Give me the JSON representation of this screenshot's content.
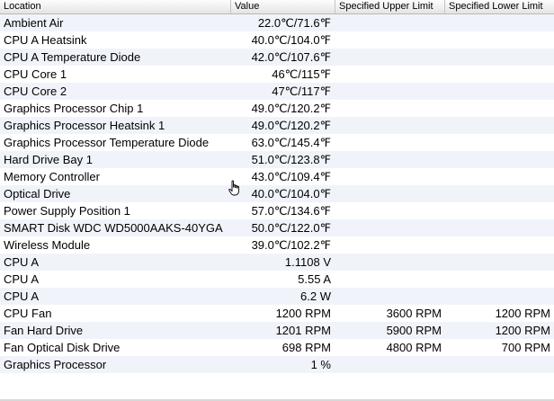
{
  "headers": {
    "location": "Location",
    "value": "Value",
    "upper": "Specified Upper Limit",
    "lower": "Specified Lower Limit"
  },
  "rows": [
    {
      "location": "Ambient Air",
      "value": "22.0℃/71.6℉",
      "upper": "",
      "lower": ""
    },
    {
      "location": "CPU A Heatsink",
      "value": "40.0℃/104.0℉",
      "upper": "",
      "lower": ""
    },
    {
      "location": "CPU A Temperature Diode",
      "value": "42.0℃/107.6℉",
      "upper": "",
      "lower": ""
    },
    {
      "location": "CPU Core 1",
      "value": "46℃/115℉",
      "upper": "",
      "lower": ""
    },
    {
      "location": "CPU Core 2",
      "value": "47℃/117℉",
      "upper": "",
      "lower": ""
    },
    {
      "location": "Graphics Processor Chip 1",
      "value": "49.0℃/120.2℉",
      "upper": "",
      "lower": ""
    },
    {
      "location": "Graphics Processor Heatsink 1",
      "value": "49.0℃/120.2℉",
      "upper": "",
      "lower": ""
    },
    {
      "location": "Graphics Processor Temperature Diode",
      "value": "63.0℃/145.4℉",
      "upper": "",
      "lower": ""
    },
    {
      "location": "Hard Drive Bay 1",
      "value": "51.0℃/123.8℉",
      "upper": "",
      "lower": ""
    },
    {
      "location": "Memory Controller",
      "value": "43.0℃/109.4℉",
      "upper": "",
      "lower": ""
    },
    {
      "location": "Optical Drive",
      "value": "40.0℃/104.0℉",
      "upper": "",
      "lower": ""
    },
    {
      "location": "Power Supply Position 1",
      "value": "57.0℃/134.6℉",
      "upper": "",
      "lower": ""
    },
    {
      "location": "SMART Disk WDC WD5000AAKS-40YGA",
      "value": "50.0℃/122.0℉",
      "upper": "",
      "lower": ""
    },
    {
      "location": "Wireless Module",
      "value": "39.0℃/102.2℉",
      "upper": "",
      "lower": ""
    },
    {
      "location": "CPU A",
      "value": "1.1108 V",
      "upper": "",
      "lower": ""
    },
    {
      "location": "CPU A",
      "value": "5.55 A",
      "upper": "",
      "lower": ""
    },
    {
      "location": "CPU A",
      "value": "6.2 W",
      "upper": "",
      "lower": ""
    },
    {
      "location": "CPU Fan",
      "value": "1200 RPM",
      "upper": "3600 RPM",
      "lower": "1200 RPM"
    },
    {
      "location": "Fan Hard Drive",
      "value": "1201 RPM",
      "upper": "5900 RPM",
      "lower": "1200 RPM"
    },
    {
      "location": "Fan Optical Disk Drive",
      "value": "698 RPM",
      "upper": "4800 RPM",
      "lower": "700 RPM"
    },
    {
      "location": "Graphics Processor",
      "value": "1 %",
      "upper": "",
      "lower": ""
    }
  ],
  "icons": {
    "cursor": "hand-pointer-icon"
  },
  "colors": {
    "stripe": "#f0f4fa",
    "header_border": "#b9b9b9"
  }
}
